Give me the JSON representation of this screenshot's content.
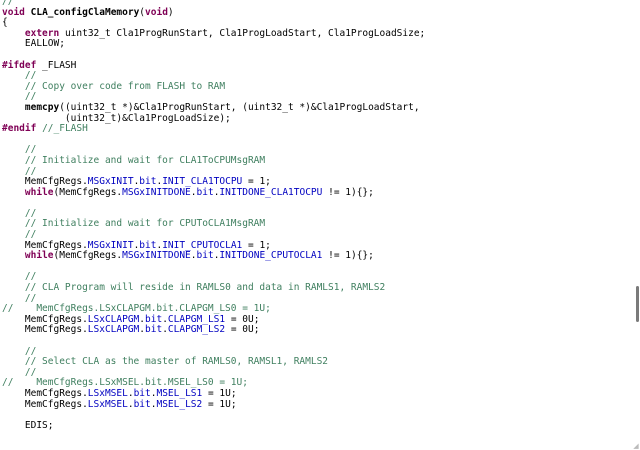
{
  "colors": {
    "keyword": "#7f0055",
    "comment": "#3f7f5f",
    "field": "#0000c0",
    "text": "#000000",
    "background": "#ffffff"
  },
  "editor": {
    "lines": [
      [
        {
          "t": "//",
          "c": "cm"
        }
      ],
      [
        {
          "t": "void",
          "c": "kw"
        },
        {
          "t": " "
        },
        {
          "t": "CLA_configClaMemory",
          "c": "bold"
        },
        {
          "t": "("
        },
        {
          "t": "void",
          "c": "kw"
        },
        {
          "t": ")"
        }
      ],
      [
        {
          "t": "{"
        }
      ],
      [
        {
          "t": "    "
        },
        {
          "t": "extern",
          "c": "kw"
        },
        {
          "t": " uint32_t Cla1ProgRunStart, Cla1ProgLoadStart, Cla1ProgLoadSize;"
        }
      ],
      [
        {
          "t": "    EALLOW;"
        }
      ],
      [],
      [
        {
          "t": "#ifdef",
          "c": "pp"
        },
        {
          "t": " _FLASH"
        }
      ],
      [
        {
          "t": "    "
        },
        {
          "t": "//",
          "c": "cm"
        }
      ],
      [
        {
          "t": "    "
        },
        {
          "t": "// Copy over code from FLASH to RAM",
          "c": "cm"
        }
      ],
      [
        {
          "t": "    "
        },
        {
          "t": "//",
          "c": "cm"
        }
      ],
      [
        {
          "t": "    "
        },
        {
          "t": "memcpy",
          "c": "bold"
        },
        {
          "t": "((uint32_t *)&Cla1ProgRunStart, (uint32_t *)&Cla1ProgLoadStart,"
        }
      ],
      [
        {
          "t": "           (uint32_t)&Cla1ProgLoadSize);"
        }
      ],
      [
        {
          "t": "#endif",
          "c": "pp"
        },
        {
          "t": " "
        },
        {
          "t": "//_FLASH",
          "c": "cm"
        }
      ],
      [],
      [
        {
          "t": "    "
        },
        {
          "t": "//",
          "c": "cm"
        }
      ],
      [
        {
          "t": "    "
        },
        {
          "t": "// Initialize and wait for CLA1ToCPUMsgRAM",
          "c": "cm"
        }
      ],
      [
        {
          "t": "    "
        },
        {
          "t": "//",
          "c": "cm"
        }
      ],
      [
        {
          "t": "    MemCfgRegs."
        },
        {
          "t": "MSGxINIT",
          "c": "fld"
        },
        {
          "t": "."
        },
        {
          "t": "bit",
          "c": "fld"
        },
        {
          "t": "."
        },
        {
          "t": "INIT_CLA1TOCPU",
          "c": "fld"
        },
        {
          "t": " = 1;"
        }
      ],
      [
        {
          "t": "    "
        },
        {
          "t": "while",
          "c": "kw"
        },
        {
          "t": "(MemCfgRegs."
        },
        {
          "t": "MSGxINITDONE",
          "c": "fld"
        },
        {
          "t": "."
        },
        {
          "t": "bit",
          "c": "fld"
        },
        {
          "t": "."
        },
        {
          "t": "INITDONE_CLA1TOCPU",
          "c": "fld"
        },
        {
          "t": " != 1){};"
        }
      ],
      [],
      [
        {
          "t": "    "
        },
        {
          "t": "//",
          "c": "cm"
        }
      ],
      [
        {
          "t": "    "
        },
        {
          "t": "// Initialize and wait for CPUToCLA1MsgRAM",
          "c": "cm"
        }
      ],
      [
        {
          "t": "    "
        },
        {
          "t": "//",
          "c": "cm"
        }
      ],
      [
        {
          "t": "    MemCfgRegs."
        },
        {
          "t": "MSGxINIT",
          "c": "fld"
        },
        {
          "t": "."
        },
        {
          "t": "bit",
          "c": "fld"
        },
        {
          "t": "."
        },
        {
          "t": "INIT_CPUTOCLA1",
          "c": "fld"
        },
        {
          "t": " = 1;"
        }
      ],
      [
        {
          "t": "    "
        },
        {
          "t": "while",
          "c": "kw"
        },
        {
          "t": "(MemCfgRegs."
        },
        {
          "t": "MSGxINITDONE",
          "c": "fld"
        },
        {
          "t": "."
        },
        {
          "t": "bit",
          "c": "fld"
        },
        {
          "t": "."
        },
        {
          "t": "INITDONE_CPUTOCLA1",
          "c": "fld"
        },
        {
          "t": " != 1){};"
        }
      ],
      [],
      [
        {
          "t": "    "
        },
        {
          "t": "//",
          "c": "cm"
        }
      ],
      [
        {
          "t": "    "
        },
        {
          "t": "// CLA Program will reside in RAMLS0 and data in RAMLS1, RAMLS2",
          "c": "cm"
        }
      ],
      [
        {
          "t": "    "
        },
        {
          "t": "//",
          "c": "cm"
        }
      ],
      [
        {
          "t": "//    MemCfgRegs.LSxCLAPGM.bit.CLAPGM_LS0 = 1U;",
          "c": "cm"
        }
      ],
      [
        {
          "t": "    MemCfgRegs."
        },
        {
          "t": "LSxCLAPGM",
          "c": "fld"
        },
        {
          "t": "."
        },
        {
          "t": "bit",
          "c": "fld"
        },
        {
          "t": "."
        },
        {
          "t": "CLAPGM_LS1",
          "c": "fld"
        },
        {
          "t": " = 0U;"
        }
      ],
      [
        {
          "t": "    MemCfgRegs."
        },
        {
          "t": "LSxCLAPGM",
          "c": "fld"
        },
        {
          "t": "."
        },
        {
          "t": "bit",
          "c": "fld"
        },
        {
          "t": "."
        },
        {
          "t": "CLAPGM_LS2",
          "c": "fld"
        },
        {
          "t": " = 0U;"
        }
      ],
      [],
      [
        {
          "t": "    "
        },
        {
          "t": "//",
          "c": "cm"
        }
      ],
      [
        {
          "t": "    "
        },
        {
          "t": "// Select CLA as the master of RAMLS0, RAMSL1, RAMLS2",
          "c": "cm"
        }
      ],
      [
        {
          "t": "    "
        },
        {
          "t": "//",
          "c": "cm"
        }
      ],
      [
        {
          "t": "//    MemCfgRegs.LSxMSEL.bit.MSEL_LS0 = 1U;",
          "c": "cm"
        }
      ],
      [
        {
          "t": "    MemCfgRegs."
        },
        {
          "t": "LSxMSEL",
          "c": "fld"
        },
        {
          "t": "."
        },
        {
          "t": "bit",
          "c": "fld"
        },
        {
          "t": "."
        },
        {
          "t": "MSEL_LS1",
          "c": "fld"
        },
        {
          "t": " = 1U;"
        }
      ],
      [
        {
          "t": "    MemCfgRegs."
        },
        {
          "t": "LSxMSEL",
          "c": "fld"
        },
        {
          "t": "."
        },
        {
          "t": "bit",
          "c": "fld"
        },
        {
          "t": "."
        },
        {
          "t": "MSEL_LS2",
          "c": "fld"
        },
        {
          "t": " = 1U;"
        }
      ],
      [],
      [
        {
          "t": "    EDIS;"
        }
      ],
      [],
      []
    ]
  }
}
